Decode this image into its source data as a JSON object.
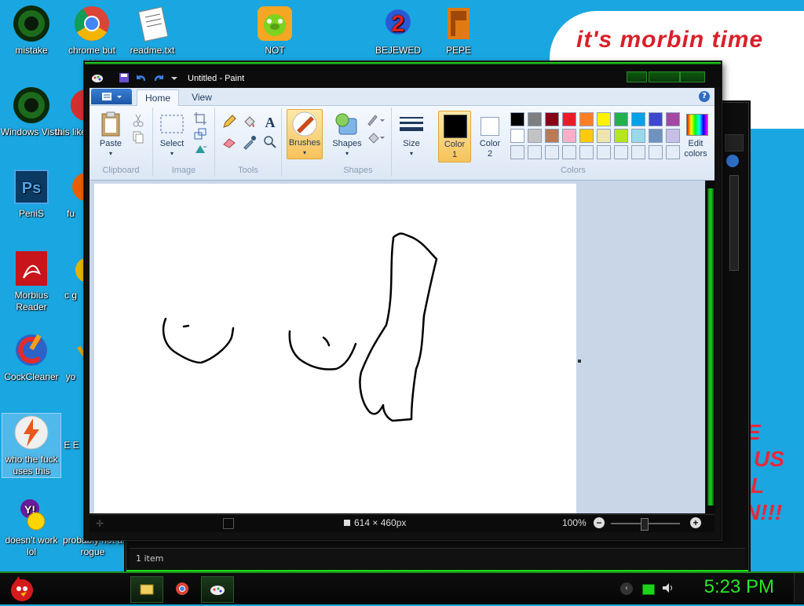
{
  "desktop": {
    "icons": [
      {
        "label": "mistake"
      },
      {
        "label": "chrome but nor"
      },
      {
        "label": "readme.txt"
      },
      {
        "label": "NOT"
      },
      {
        "label": "BEJEWED"
      },
      {
        "label": "PEPE"
      },
      {
        "label": "Windows Vista"
      },
      {
        "label": "this like"
      },
      {
        "label": "PeniS"
      },
      {
        "label": "fu"
      },
      {
        "label": "Morbius Reader"
      },
      {
        "label": "c g"
      },
      {
        "label": "CockCleaner"
      },
      {
        "label": "yo"
      },
      {
        "label": "who the fuck uses this"
      },
      {
        "label": "E E"
      },
      {
        "label": "doesn't work lol"
      },
      {
        "label": "probably not a rogue"
      }
    ],
    "cloud_text": "it's morbin time",
    "red_text": [
      "E",
      "US",
      "L",
      "N!!!"
    ]
  },
  "background_window": {
    "status_text": "1 item"
  },
  "paint": {
    "title": "Untitled - Paint",
    "tabs": [
      "Home",
      "View"
    ],
    "help": "?",
    "groups": {
      "clipboard": {
        "label": "Clipboard",
        "paste": "Paste"
      },
      "image": {
        "label": "Image",
        "select": "Select"
      },
      "tools": {
        "label": "Tools"
      },
      "brushes": "Brushes",
      "shapes": {
        "label": "Shapes",
        "shapes": "Shapes"
      },
      "size": "Size",
      "colors": {
        "label": "Colors",
        "color1": "Color\n1",
        "color2": "Color\n2",
        "edit": "Edit colors"
      }
    },
    "palette_row1": [
      "#000000",
      "#7f7f7f",
      "#880015",
      "#ed1c24",
      "#ff7f27",
      "#fff200",
      "#22b14c",
      "#00a2e8",
      "#3f48cc",
      "#a349a4"
    ],
    "palette_row2": [
      "#ffffff",
      "#c3c3c3",
      "#b97a57",
      "#ffaec9",
      "#ffc90e",
      "#efe4b0",
      "#b5e61d",
      "#99d9ea",
      "#7092be",
      "#c8bfe7"
    ],
    "status": {
      "dimensions": "614 × 460px",
      "zoom": "100%"
    }
  },
  "taskbar": {
    "clock": "5:23 PM"
  }
}
